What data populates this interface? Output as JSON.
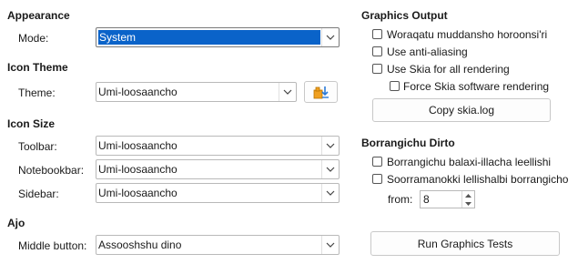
{
  "appearance": {
    "heading": "Appearance",
    "mode_label": "Mode:",
    "mode_value": "System"
  },
  "icon_theme": {
    "heading": "Icon Theme",
    "theme_label": "Theme:",
    "theme_value": "Umi-loosaancho"
  },
  "icon_size": {
    "heading": "Icon Size",
    "toolbar_label": "Toolbar:",
    "toolbar_value": "Umi-loosaancho",
    "notebookbar_label": "Notebookbar:",
    "notebookbar_value": "Umi-loosaancho",
    "sidebar_label": "Sidebar:",
    "sidebar_value": "Umi-loosaancho"
  },
  "ajo": {
    "heading": "Ajo",
    "middle_button_label": "Middle button:",
    "middle_button_value": "Assooshshu dino"
  },
  "graphics_output": {
    "heading": "Graphics Output",
    "opt_hw": "Woraqatu muddansho horoonsi'ri",
    "opt_aa": "Use anti-aliasing",
    "opt_skia": "Use Skia for all rendering",
    "opt_skia_sw": "Force Skia software rendering",
    "copy_button": "Copy skia.log"
  },
  "borrangichu": {
    "heading": "Borrangichu Dirto",
    "opt_preview": "Borrangichu balaxi-illacha leellishi",
    "opt_screen": "Soorramanokki lellishalbi borrangicho",
    "from_label": "from:",
    "from_value": "8"
  },
  "run_tests_button": "Run Graphics Tests",
  "colors": {
    "selection": "#0a63c9",
    "icon_accent": "#f0a020",
    "icon_blue": "#2a7ad8"
  }
}
